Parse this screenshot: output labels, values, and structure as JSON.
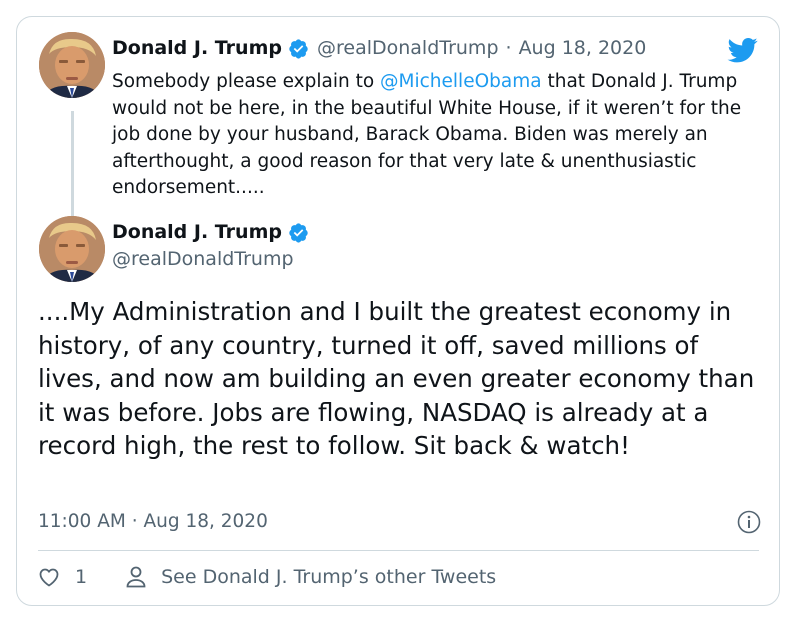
{
  "quoted_tweet": {
    "author_name": "Donald J. Trump",
    "handle": "@realDonaldTrump",
    "separator": "·",
    "date": "Aug 18, 2020",
    "text_before_mention": "Somebody please explain to ",
    "mention": "@MichelleObama",
    "text_after_mention": " that Donald J. Trump would not be here, in the beautiful White House, if it weren’t for the job done by your husband, Barack Obama. Biden was merely an afterthought, a good reason for that very late &  unenthusiastic endorsement....."
  },
  "main_tweet": {
    "author_name": "Donald J. Trump",
    "handle": "@realDonaldTrump",
    "text": "....My Administration and I built the greatest economy in history, of any country, turned it off, saved millions of lives, and now am building an even greater economy than it was before. Jobs are flowing, NASDAQ is already at a record high, the rest to follow. Sit back & watch!",
    "timestamp": "11:00 AM · Aug 18, 2020"
  },
  "actions": {
    "like_count": "1",
    "other_tweets_label": "See Donald J. Trump’s other Tweets"
  },
  "icons": {
    "brand": "twitter-bird-icon",
    "verified": "verified-badge-icon",
    "info": "info-icon",
    "like": "heart-icon",
    "profile": "person-icon"
  },
  "colors": {
    "accent": "#1d9bf0",
    "text": "#0f1419",
    "secondary": "#536471",
    "border": "#cfd9de"
  }
}
